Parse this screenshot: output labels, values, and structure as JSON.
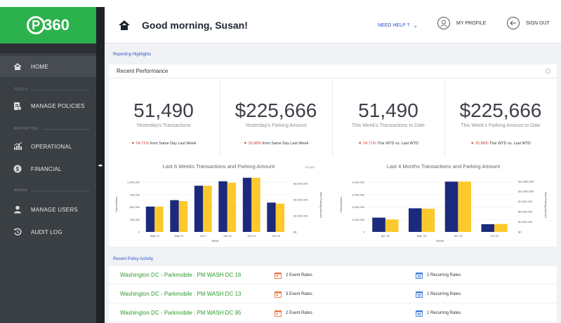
{
  "brand": {
    "logo_text": "360",
    "logo_p": "P"
  },
  "sidebar": {
    "sections": [
      "TOOLS",
      "REPORTING",
      "ADMIN"
    ],
    "items": [
      {
        "label": "HOME",
        "icon": "home-icon"
      },
      {
        "label": "MANAGE POLICIES",
        "icon": "policies-icon"
      },
      {
        "label": "OPERATIONAL",
        "icon": "chart-icon"
      },
      {
        "label": "FINANCIAL",
        "icon": "dollar-icon"
      },
      {
        "label": "MANAGE USERS",
        "icon": "user-icon"
      },
      {
        "label": "AUDIT LOG",
        "icon": "history-icon"
      }
    ]
  },
  "header": {
    "greeting": "Good morning, Susan!",
    "help": "NEED HELP ?",
    "profile": "MY PROFILE",
    "signout": "SIGN OUT"
  },
  "main": {
    "reporting_title": "Reporting Highlights",
    "perf_title": "Recent Performance",
    "kpis": [
      {
        "value": "51,490",
        "label": "Yesterday's Transactions",
        "pct": "24.71%",
        "comparison": "from Same Day Last Week"
      },
      {
        "value": "$225,666",
        "label": "Yesterday's Parking Amount",
        "pct": "25.88%",
        "comparison": "from Same Day Last Week"
      },
      {
        "value": "51,490",
        "label": "This Week's Transactions to Date",
        "pct": "24.71%",
        "comparison": "This WTD vs. Last WTD"
      },
      {
        "value": "$225,666",
        "label": "This Week's Parking Amount to Date",
        "pct": "25.88%",
        "comparison": "This WTD vs. Last WTD"
      }
    ],
    "activity_title": "Recent Policy Activity",
    "activity": [
      {
        "name": "Washington DC - Parkmobile : PM WASH DC 16",
        "event_rates": "2 Event Rates",
        "recurring_rates": "1 Recurring Rates"
      },
      {
        "name": "Washington DC - Parkmobile : PM WASH DC 13",
        "event_rates": "3 Event Rates",
        "recurring_rates": "1 Recurring Rates"
      },
      {
        "name": "Washington DC - Parkmobile : PM WASH DC 95",
        "event_rates": "2 Event Rates",
        "recurring_rates": "1 Recurring Rates"
      }
    ]
  },
  "colors": {
    "brand_green": "#2bb24c",
    "bar_navy": "#1b2a7c",
    "bar_yellow": "#fcc92c",
    "link_blue": "#2a53c6",
    "negative_red": "#d23a3a"
  },
  "chart_data": [
    {
      "type": "bar",
      "title": "Last 6 Weeks Transactions and Parking Amount",
      "note": "4d ago",
      "xlabel": "Week",
      "ylabel": "Transactions",
      "y2label": "Total Parking Amount",
      "categories": [
        "May 24",
        "May 31",
        "Jun 7",
        "Jun 14",
        "Jun 21",
        "Jun 28"
      ],
      "yticks": [
        "0",
        "250,000",
        "500,000",
        "750,000",
        "1,000,000"
      ],
      "y2ticks": [
        "$0",
        "$1,000,000",
        "$2,000,000",
        "$3,000,000"
      ],
      "ylim": [
        0,
        1100000
      ],
      "series": [
        {
          "name": "Transactions",
          "values": [
            510000,
            640000,
            930000,
            1020000,
            1090000,
            590000
          ]
        },
        {
          "name": "Total Parking Amount",
          "values": [
            510000,
            620000,
            930000,
            990000,
            1090000,
            570000
          ]
        }
      ],
      "grid": true
    },
    {
      "type": "bar",
      "title": "Last 4 Months Transactions and Parking Amount",
      "xlabel": "Month",
      "ylabel": "Transactions",
      "y2label": "Total Parking Amount",
      "categories": [
        "Apr '20",
        "May '20",
        "Jun '20",
        "Jul '20"
      ],
      "yticks": [
        "0",
        "1,000,000",
        "2,000,000",
        "3,000,000",
        "4,000,000"
      ],
      "y2ticks": [
        "$0",
        "$2,500,000",
        "$5,000,000",
        "$7,500,000",
        "$10,000,000",
        "$12,500,000"
      ],
      "ylim": [
        0,
        4400000
      ],
      "series": [
        {
          "name": "Transactions",
          "values": [
            1150000,
            1900000,
            4050000,
            620000
          ]
        },
        {
          "name": "Total Parking Amount",
          "values": [
            1000000,
            1870000,
            4050000,
            640000
          ]
        }
      ],
      "grid": true
    }
  ]
}
